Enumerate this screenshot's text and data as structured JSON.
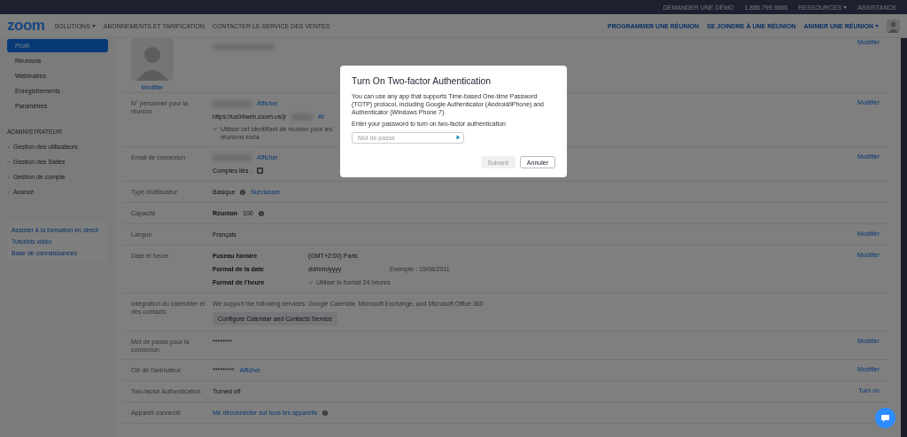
{
  "top_bar": {
    "links": [
      {
        "label": "DEMANDER UNE DÉMO",
        "dropdown": false
      },
      {
        "label": "1.888.799.9666",
        "dropdown": false
      },
      {
        "label": "RESSOURCES",
        "dropdown": true
      },
      {
        "label": "ASSISTANCE",
        "dropdown": false
      }
    ]
  },
  "nav": {
    "logo": "zoom",
    "links": [
      {
        "label": "SOLUTIONS",
        "dropdown": true
      },
      {
        "label": "ABONNEMENTS ET TARIFICATION",
        "dropdown": false
      },
      {
        "label": "CONTACTER LE SERVICE DES VENTES",
        "dropdown": false
      }
    ],
    "right_links": [
      {
        "label": "PROGRAMMER UNE RÉUNION",
        "dropdown": false
      },
      {
        "label": "SE JOINDRE À UNE RÉUNION",
        "dropdown": false
      },
      {
        "label": "ANIMER UNE RÉUNION",
        "dropdown": true
      }
    ]
  },
  "sidebar": {
    "items": [
      {
        "label": "Profil",
        "selected": true
      },
      {
        "label": "Réunions",
        "selected": false
      },
      {
        "label": "Webinaires",
        "selected": false
      },
      {
        "label": "Enregistrements",
        "selected": false
      },
      {
        "label": "Paramètres",
        "selected": false
      }
    ],
    "admin_heading": "ADMINISTRATEUR",
    "admin_items": [
      {
        "label": "Gestion des utilisateurs",
        "expanded": false
      },
      {
        "label": "Gestion des Salles",
        "expanded": false
      },
      {
        "label": "Gestion de compte",
        "expanded": false
      },
      {
        "label": "Avancé",
        "expanded": false
      }
    ],
    "help_links": [
      "Assister à la formation en direct",
      "Tutoriels vidéo",
      "Base de connaissances"
    ]
  },
  "profile": {
    "avatar_link": "Modifier",
    "action": "Modifier"
  },
  "rows": [
    {
      "label": "N° personnel pour la réunion",
      "action": "Modifier",
      "lines": [
        [
          {
            "kind": "redacted"
          },
          {
            "kind": "link",
            "text": "Afficher"
          }
        ],
        [
          {
            "kind": "text",
            "text": "https://us04web.zoom.us/j/"
          },
          {
            "kind": "redacted_wide"
          },
          {
            "kind": "link",
            "text": "Af"
          }
        ],
        [
          {
            "kind": "checkbox",
            "checked": true,
            "text": "Utiliser cet identifiant de réunion pour les réunions insta"
          }
        ]
      ]
    },
    {
      "label": "Email de connexion",
      "action": "Modifier",
      "lines": [
        [
          {
            "kind": "redacted"
          },
          {
            "kind": "link",
            "text": "Afficher"
          }
        ],
        [
          {
            "kind": "text",
            "text": "Comptes liés :"
          },
          {
            "kind": "account_icon"
          }
        ]
      ]
    },
    {
      "label": "Type d'utilisateur",
      "lines": [
        [
          {
            "kind": "text",
            "text": "Basique"
          },
          {
            "kind": "info"
          },
          {
            "kind": "link",
            "text": "Surclasser"
          }
        ]
      ]
    },
    {
      "label": "Capacité",
      "lines": [
        [
          {
            "kind": "strong",
            "text": "Réunion"
          },
          {
            "kind": "text",
            "text": "100"
          },
          {
            "kind": "info"
          }
        ]
      ]
    },
    {
      "label": "Langue",
      "action": "Modifier",
      "lines": [
        [
          {
            "kind": "text",
            "text": "Français"
          }
        ]
      ]
    },
    {
      "label": "Date et heure",
      "action": "Modifier",
      "lines": [
        [
          {
            "kind": "field_label",
            "text": "Fuseau horaire"
          },
          {
            "kind": "value",
            "text": "(GMT+2:00) Paris"
          }
        ],
        [
          {
            "kind": "field_label",
            "text": "Format de la date"
          },
          {
            "kind": "value",
            "text": "dd/mm/yyyy"
          },
          {
            "kind": "muted",
            "text": "Exemple : 15/08/2011"
          }
        ],
        [
          {
            "kind": "field_label",
            "text": "Format de l'heure"
          },
          {
            "kind": "checkbox",
            "checked": true,
            "text": "Utiliser le format 24 heures"
          }
        ]
      ]
    },
    {
      "label": "Intégration du calendrier et des contacts",
      "lines": [
        [
          {
            "kind": "muted",
            "text": "We support the following services: Google Calendar, Microsoft Exchange, and Microsoft Office 365"
          }
        ],
        [
          {
            "kind": "button",
            "text": "Configure Calendar and Contacts Service"
          }
        ]
      ]
    },
    {
      "label": "Mot de passe pour la connexion",
      "action": "Modifier",
      "lines": [
        [
          {
            "kind": "text",
            "text": "********"
          }
        ]
      ]
    },
    {
      "label": "Clé de l'animateur",
      "action": "Modifier",
      "lines": [
        [
          {
            "kind": "text",
            "text": "*********"
          },
          {
            "kind": "link",
            "text": "Afficher"
          }
        ]
      ]
    },
    {
      "label": "Two-factor Authentication",
      "action": "Turn on",
      "lines": [
        [
          {
            "kind": "text",
            "text": "Turned off"
          }
        ]
      ]
    },
    {
      "label": "Appareil connecté",
      "lines": [
        [
          {
            "kind": "link",
            "text": "Me déconnecter sur tous les appareils"
          },
          {
            "kind": "info"
          }
        ]
      ]
    }
  ],
  "dialog": {
    "title": "Turn On Two-factor Authentication",
    "description": "You can use any app that supports Time-based One-time Password (TOTP) protocol, including Google Authenticator (Android/iPhone) and Authenticator (Windows Phone 7).",
    "prompt": "Enter your password to turn on two-factor authentication",
    "password_placeholder": "Mot de passe",
    "buttons": [
      {
        "label": "Suivant",
        "disabled": true
      },
      {
        "label": "Annuler",
        "disabled": false
      }
    ]
  }
}
